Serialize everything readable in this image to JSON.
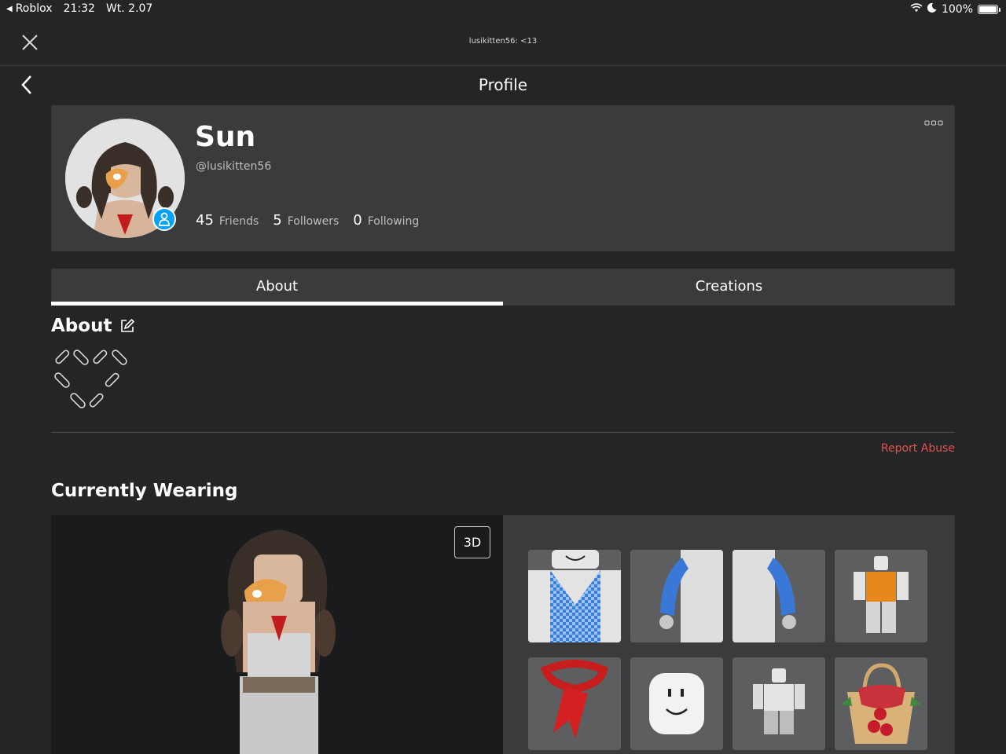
{
  "status_bar": {
    "back_app": "Roblox",
    "time": "21:32",
    "date": "Wt. 2.07",
    "battery": "100%",
    "battery_level": 1.0
  },
  "top_bar": {
    "title": "lusikitten56: <13"
  },
  "header": {
    "title": "Profile"
  },
  "profile": {
    "display_name": "Sun",
    "username": "@lusikitten56",
    "friends_count": "45",
    "friends_label": "Friends",
    "followers_count": "5",
    "followers_label": "Followers",
    "following_count": "0",
    "following_label": "Following"
  },
  "tabs": [
    {
      "label": "About",
      "active": true
    },
    {
      "label": "Creations",
      "active": false
    }
  ],
  "about": {
    "heading": "About",
    "report_label": "Report Abuse"
  },
  "wearing": {
    "heading": "Currently Wearing",
    "view_3d_label": "3D",
    "items": [
      {
        "icon": "checkered-shirt-icon"
      },
      {
        "icon": "left-sleeve-icon"
      },
      {
        "icon": "right-sleeve-icon"
      },
      {
        "icon": "orange-shirt-body-icon"
      },
      {
        "icon": "red-scarf-icon"
      },
      {
        "icon": "smile-face-icon"
      },
      {
        "icon": "pants-body-icon"
      },
      {
        "icon": "cherry-basket-icon"
      }
    ]
  },
  "colors": {
    "background": "#232527",
    "card": "#393b3d",
    "accent_blue": "#00a2ff",
    "report_red": "#e2534d"
  }
}
